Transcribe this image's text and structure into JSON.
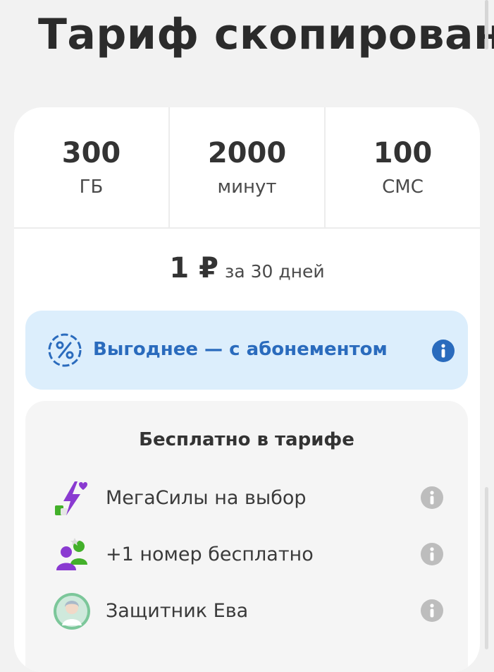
{
  "header": {
    "title": "Тариф скопирован"
  },
  "stats": [
    {
      "value": "300",
      "unit": "ГБ"
    },
    {
      "value": "2000",
      "unit": "минут"
    },
    {
      "value": "100",
      "unit": "СМС"
    }
  ],
  "price": {
    "amount": "1 ₽",
    "period": "за 30 дней"
  },
  "promo": {
    "label": "Выгоднее — с абонементом",
    "icon": "percent-badge-icon",
    "info_icon": "info-icon",
    "info_icon_color": "#2a6bbd",
    "background": "#dceefc"
  },
  "free_features": {
    "heading": "Бесплатно в тарифе",
    "items": [
      {
        "label": "МегаСилы на выбор",
        "icon": "lightning-bolt-icon",
        "info_icon": "info-icon"
      },
      {
        "label": "+1 номер бесплатно",
        "icon": "people-icon",
        "info_icon": "info-icon"
      },
      {
        "label": "Защитник Ева",
        "icon": "assistant-avatar-icon",
        "info_icon": "info-icon"
      }
    ],
    "info_icon_color": "#bdbdbd"
  },
  "colors": {
    "accent_blue": "#2a6bbd",
    "accent_purple": "#8a3ad1",
    "accent_green": "#43b02a",
    "background": "#f2f2f2",
    "card": "#ffffff"
  }
}
